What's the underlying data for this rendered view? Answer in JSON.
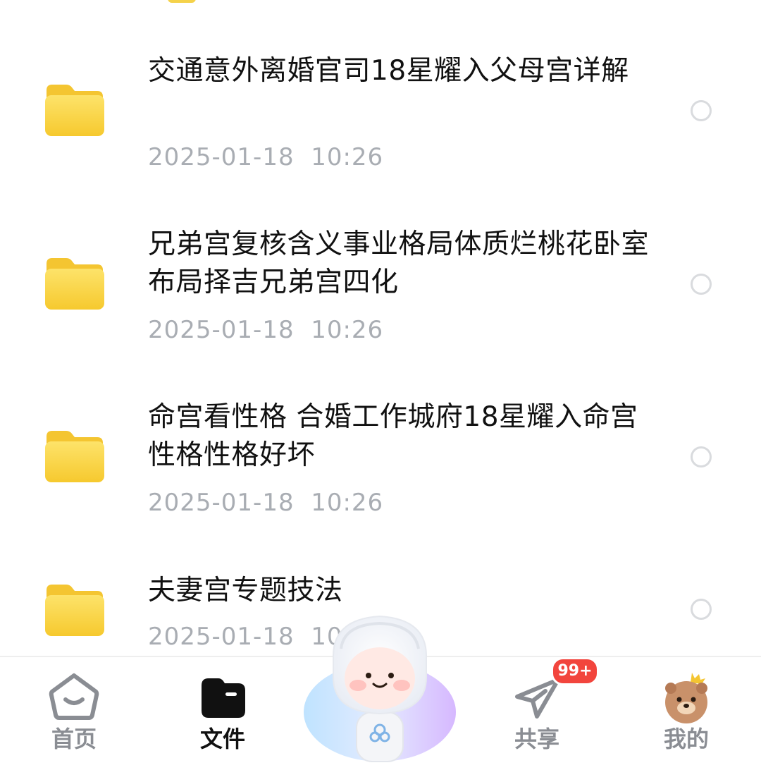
{
  "files": [
    {
      "name": "交通意外离婚官司18星耀入父母宫详解",
      "time": "2025-01-18  10:26"
    },
    {
      "name": "兄弟宫复核含义事业格局体质烂桃花卧室布局择吉兄弟宫四化",
      "time": "2025-01-18  10:26"
    },
    {
      "name": "命宫看性格 合婚工作城府18星耀入命宫性格性格好坏",
      "time": "2025-01-18  10:26"
    },
    {
      "name": "夫妻宫专题技法",
      "time": "2025-01-18  10:"
    }
  ],
  "tabs": {
    "home": {
      "label": "首页",
      "icon": "home-icon"
    },
    "files": {
      "label": "文件",
      "icon": "folder-icon"
    },
    "share": {
      "label": "共享",
      "icon": "send-icon",
      "badge": "99+"
    },
    "mine": {
      "label": "我的",
      "icon": "avatar-icon"
    }
  },
  "colors": {
    "folder": "#f8d23f",
    "timestamp": "#a9adb3",
    "badge": "#f2453d",
    "active_tab": "#111111",
    "inactive_tab": "#8a8d93"
  }
}
